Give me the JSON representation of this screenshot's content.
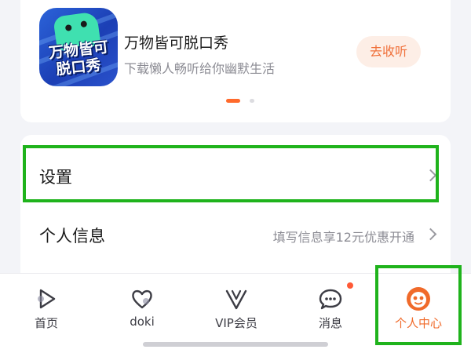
{
  "promo": {
    "icon_text_line1": "万物皆可",
    "icon_text_line2": "脱口秀",
    "title": "万物皆可脱口秀",
    "subtitle": "下载懒人畅听给你幽默生活",
    "button_label": "去收听"
  },
  "list": {
    "items": [
      {
        "label": "设置",
        "extra": ""
      },
      {
        "label": "个人信息",
        "extra": "填写信息享12元优惠开通"
      }
    ]
  },
  "tabbar": {
    "tabs": [
      {
        "label": "首页",
        "icon": "play-icon",
        "active": false
      },
      {
        "label": "doki",
        "icon": "heart-icon",
        "active": false
      },
      {
        "label": "VIP会员",
        "icon": "vip-v-icon",
        "active": false
      },
      {
        "label": "消息",
        "icon": "chat-bubble-icon",
        "active": false,
        "badge": true
      },
      {
        "label": "个人中心",
        "icon": "mascot-face-icon",
        "active": true
      }
    ]
  },
  "colors": {
    "accent": "#f06a2a",
    "highlight": "#1fb31c",
    "badge": "#ff5a36"
  }
}
